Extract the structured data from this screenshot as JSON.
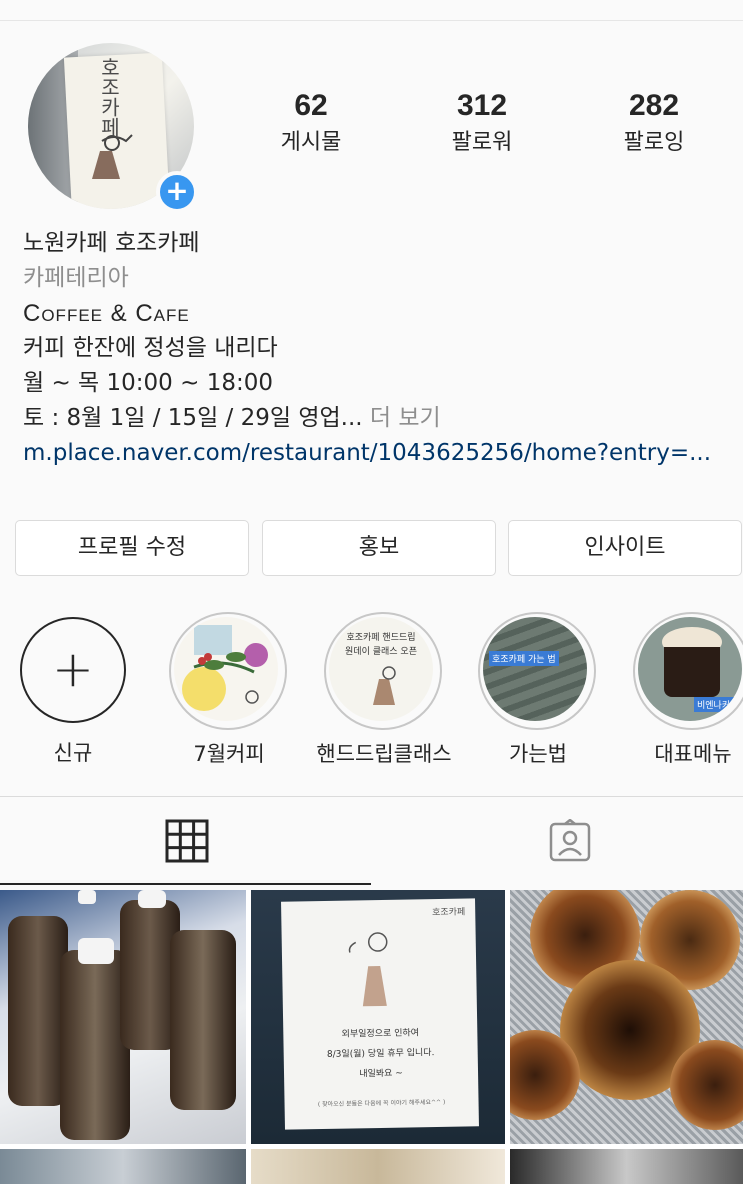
{
  "profile": {
    "avatar_text": "호조카페",
    "stats": [
      {
        "value": "62",
        "label": "게시물"
      },
      {
        "value": "312",
        "label": "팔로워"
      },
      {
        "value": "282",
        "label": "팔로잉"
      }
    ],
    "name": "노원카페 호조카페",
    "category": "카페테리아",
    "bio_lines": [
      "Coffee & Cafe",
      "커피 한잔에 정성을 내리다",
      "월 ~ 목 10:00 ~ 18:00",
      "토 : 8월 1일 / 15일 / 29일 영업..."
    ],
    "more_label": " 더 보기",
    "link": "m.place.naver.com/restaurant/1043625256/home?entry=..."
  },
  "actions": {
    "edit_profile": "프로필 수정",
    "promote": "홍보",
    "insights": "인사이트"
  },
  "highlights": [
    {
      "label": "신규"
    },
    {
      "label": "7월커피"
    },
    {
      "label": "핸드드립클래스",
      "cover_text": "호조카페 핸드드립\n원데이 클래스 오픈"
    },
    {
      "label": "가는법",
      "cover_text": "호조카페 가는 법"
    },
    {
      "label": "대표메뉴",
      "cover_text": "비엔나커피"
    }
  ],
  "tabs": [
    {
      "name": "grid-icon",
      "active": true
    },
    {
      "name": "tagged-icon",
      "active": false
    }
  ],
  "posts": {
    "notice_title": "호조카페",
    "notice_lines": [
      "외부일정으로 인하여",
      "8/3일(월) 당일 휴무 입니다.",
      "내일봐요 ~"
    ],
    "notice_footer": "( 찾아오신 분들은 다음에 꼭 이야기 해주세요^^ )"
  },
  "colors": {
    "accent_blue": "#3897f0",
    "link": "#003569",
    "muted": "#8e8e8e",
    "border": "#dbdbdb"
  }
}
